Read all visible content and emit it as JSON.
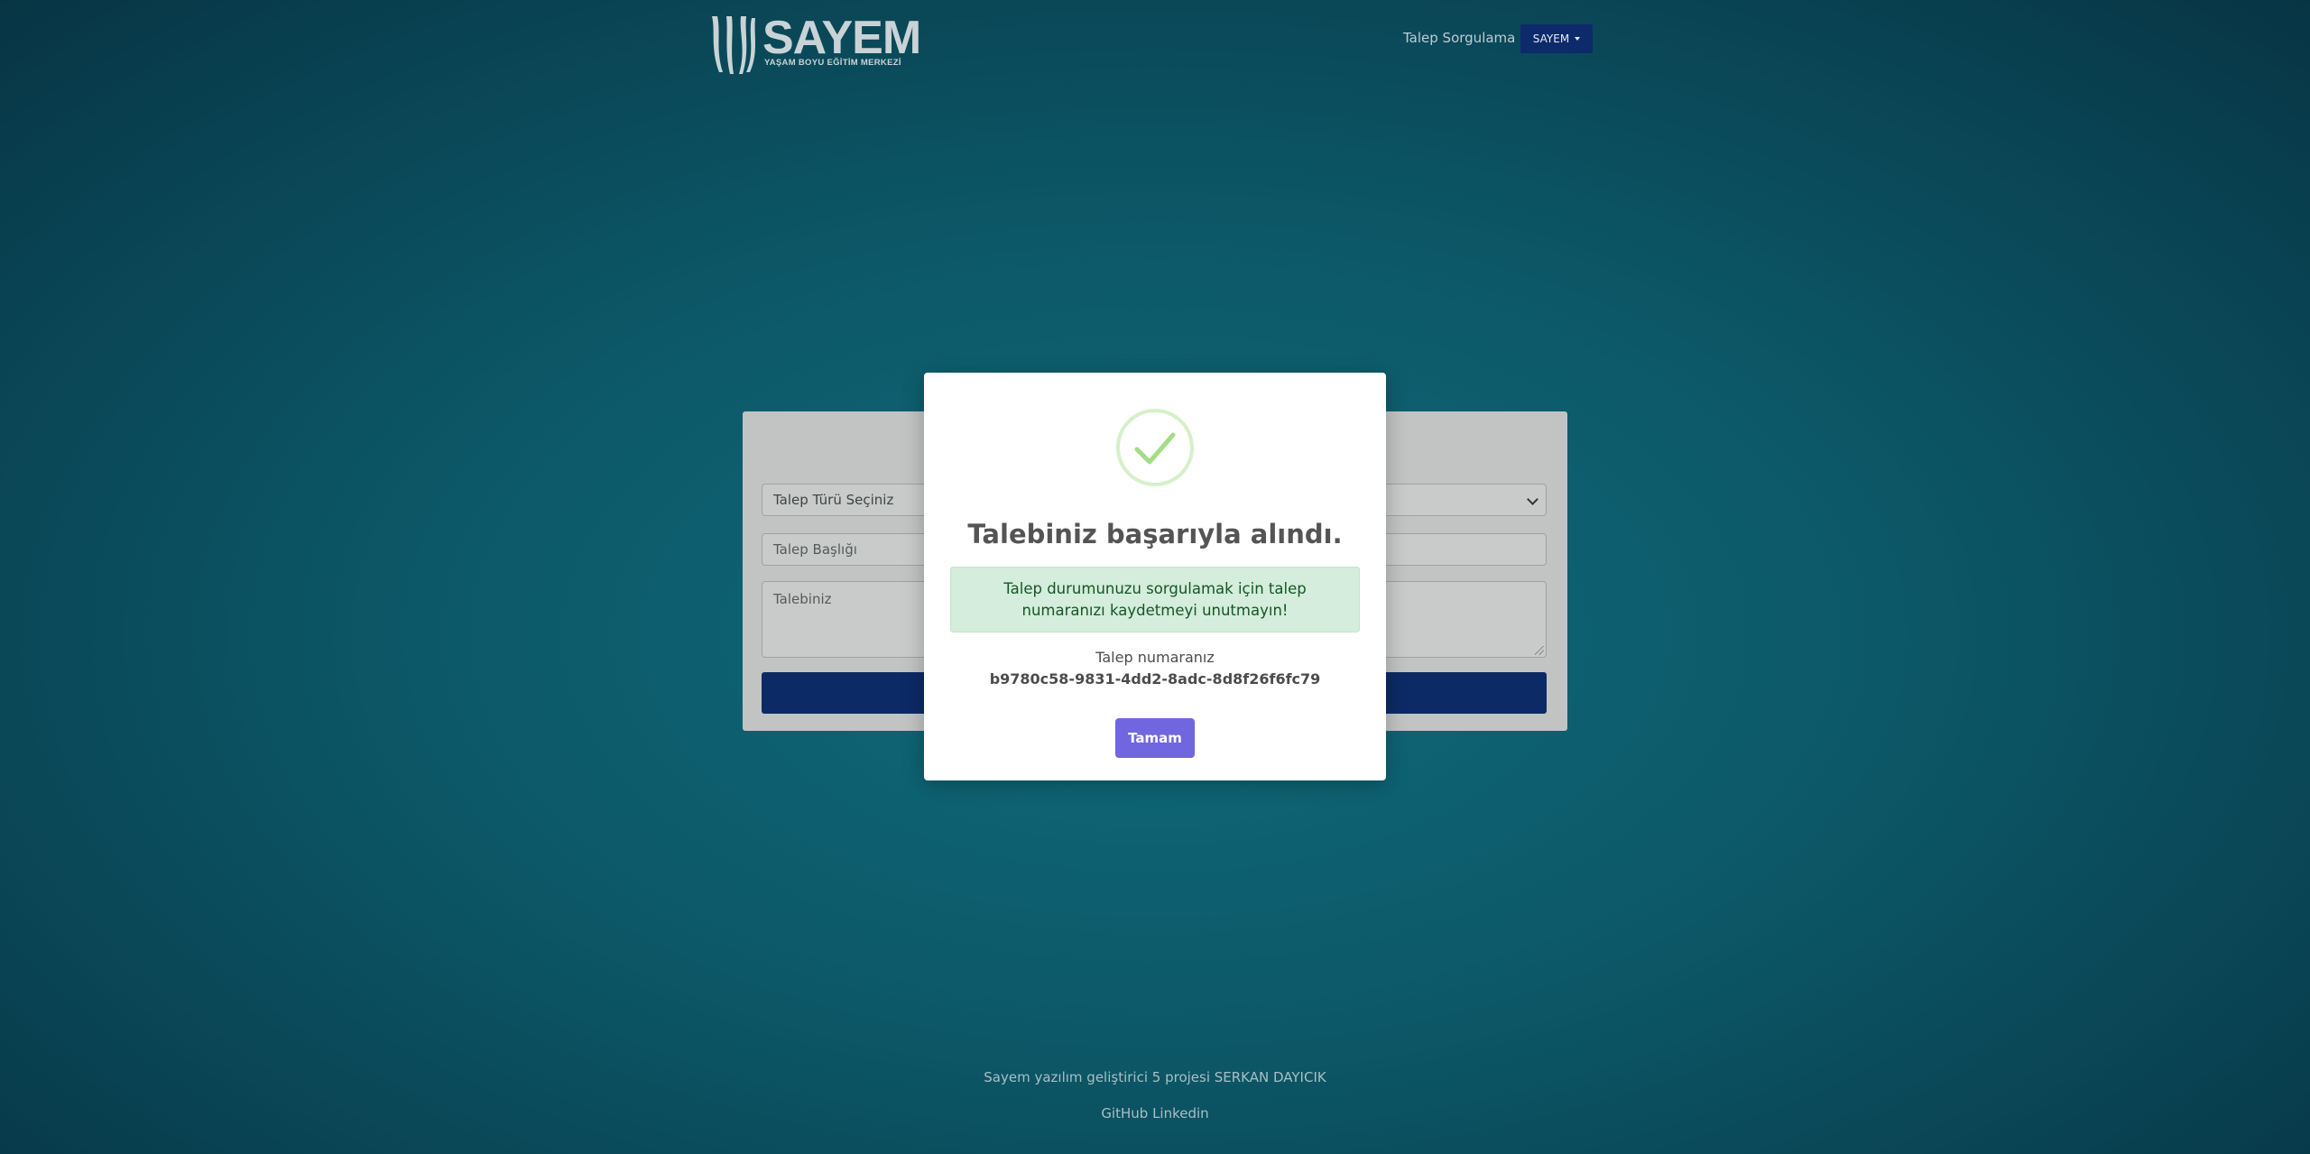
{
  "header": {
    "logo": {
      "brand": "SAYEM",
      "tagline": "YAŞAM BOYU EĞİTİM MERKEZİ"
    },
    "nav": {
      "query_link": "Talep Sorgulama",
      "dropdown_label": "SAYEM"
    }
  },
  "form": {
    "select_value": "Talep Türü Seçiniz",
    "title_placeholder": "Talep Başlığı",
    "body_placeholder": "Talebiniz"
  },
  "modal": {
    "icon": "check-icon",
    "title": "Talebiniz başarıyla alındı.",
    "info": "Talep durumunuzu sorgulamak için talep numaranızı kaydetmeyi unutmayın!",
    "request_label": "Talep numaranız",
    "request_number": "b9780c58-9831-4dd2-8adc-8d8f26f6fc79",
    "ok_button": "Tamam"
  },
  "footer": {
    "credit": "Sayem yazılım geliştirici 5 projesi SERKAN DAYICIK",
    "links": [
      "GitHub",
      "Linkedin"
    ]
  },
  "colors": {
    "background": "#0c5868",
    "nav_dropdown": "#0d2a6a",
    "confirm_button": "#7066e0",
    "success_box": "#d4eddc",
    "success_icon": "#a5dc86"
  }
}
